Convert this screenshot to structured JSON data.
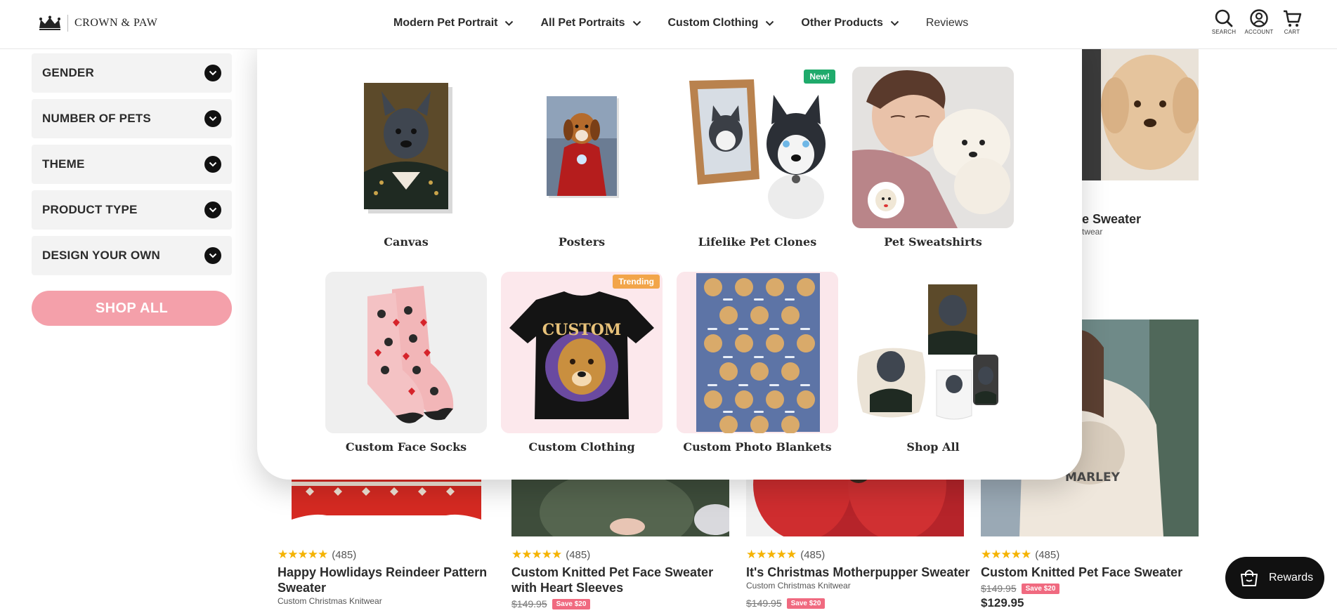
{
  "brand": {
    "name": "CROWN & PAW",
    "logo_icon": "crown-icon"
  },
  "nav": {
    "items": [
      {
        "label": "Modern Pet Portrait",
        "has_dropdown": true
      },
      {
        "label": "All Pet Portraits",
        "has_dropdown": true
      },
      {
        "label": "Custom Clothing",
        "has_dropdown": true
      },
      {
        "label": "Other Products",
        "has_dropdown": true
      },
      {
        "label": "Reviews",
        "has_dropdown": false
      }
    ]
  },
  "utilities": [
    {
      "label": "SEARCH",
      "icon": "search-icon"
    },
    {
      "label": "ACCOUNT",
      "icon": "account-icon"
    },
    {
      "label": "CART",
      "icon": "cart-icon"
    }
  ],
  "filters": [
    {
      "label": "GENDER"
    },
    {
      "label": "NUMBER OF PETS"
    },
    {
      "label": "THEME"
    },
    {
      "label": "PRODUCT TYPE"
    },
    {
      "label": "DESIGN YOUR OWN"
    }
  ],
  "shop_all_label": "SHOP ALL",
  "mega_menu": {
    "tiles": [
      {
        "label": "Canvas",
        "badge": ""
      },
      {
        "label": "Posters",
        "badge": ""
      },
      {
        "label": "Lifelike Pet Clones",
        "badge": "New!"
      },
      {
        "label": "Pet Sweatshirts",
        "badge": ""
      },
      {
        "label": "Custom Face Socks",
        "badge": ""
      },
      {
        "label": "Custom Clothing",
        "badge": "Trending"
      },
      {
        "label": "Custom Photo Blankets",
        "badge": ""
      },
      {
        "label": "Shop All",
        "badge": ""
      }
    ]
  },
  "products": [
    {
      "stars": "★★★★★",
      "reviews": "(485)",
      "title": "Happy Howlidays Reindeer Pattern Sweater",
      "subtitle": "Custom Christmas Knitwear",
      "old_price": "",
      "save": "",
      "price": ""
    },
    {
      "stars": "★★★★★",
      "reviews": "(485)",
      "title": "Custom Knitted Pet Face Sweater with Heart Sleeves",
      "subtitle": "",
      "old_price": "$149.95",
      "save": "Save $20",
      "price": ""
    },
    {
      "stars": "★★★★★",
      "reviews": "(485)",
      "title": "It's Christmas Motherpupper Sweater",
      "subtitle": "Custom Christmas Knitwear",
      "old_price": "$149.95",
      "save": "Save $20",
      "price": ""
    },
    {
      "stars": "★★★★★",
      "reviews": "(485)",
      "title": "Custom Knitted Pet Face Sweater",
      "subtitle": "",
      "old_price": "$149.95",
      "save": "Save $20",
      "price": "$129.95"
    }
  ],
  "peek_product": {
    "title_fragment": "e Sweater",
    "subtitle_fragment": "twear"
  },
  "rewards": {
    "label": "Rewards",
    "icon": "shopping-bag-icon"
  },
  "colors": {
    "accent_pink": "#f4a0aa",
    "save_badge": "#f06a80",
    "new_badge": "#1faa6b",
    "trending_badge": "#f2a54a",
    "star": "#f5b301"
  }
}
